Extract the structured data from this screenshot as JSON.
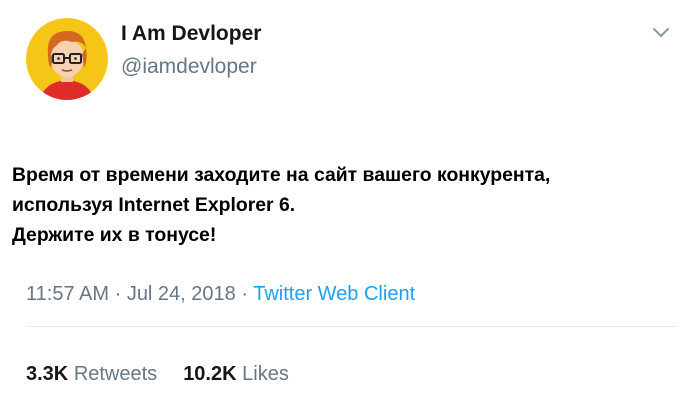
{
  "author": {
    "name": "I Am Devloper",
    "handle": "@iamdevloper"
  },
  "tweet": {
    "lines": [
      "Время от времени заходите на сайт вашего конкурента,",
      "используя Internet Explorer 6.",
      "Держите их в тонусе!"
    ]
  },
  "meta": {
    "time": "11:57 AM",
    "separator1": " · ",
    "date": "Jul 24, 2018",
    "separator2": " · ",
    "source": "Twitter Web Client"
  },
  "stats": {
    "retweets_count": "3.3K",
    "retweets_label": "Retweets",
    "likes_count": "10.2K",
    "likes_label": "Likes"
  },
  "icons": {
    "menu": "chevron-down-icon",
    "avatar": "avatar"
  },
  "colors": {
    "text": "#14171a",
    "secondary": "#657786",
    "link": "#1da1f2",
    "divider": "#e6ecf0",
    "avatar_bg": "#f5c518"
  }
}
